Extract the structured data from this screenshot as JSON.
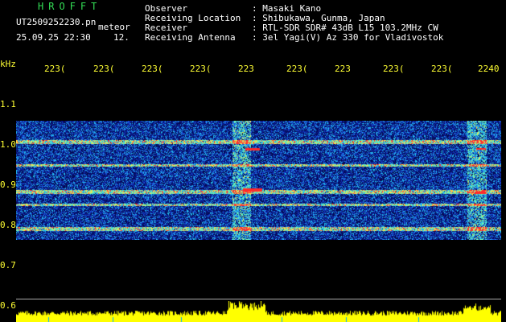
{
  "header": {
    "title_letters": "HROFFT",
    "filename": "UT2509252230.pn",
    "mode": "meteor",
    "date_time": "25.09.25 22:30",
    "frame": "12.",
    "labels": [
      "Observer",
      "Receiving Location",
      "Receiver",
      "Receiving Antenna"
    ],
    "values": [
      ": Masaki Kano",
      ": Shibukawa, Gunma, Japan",
      ": RTL-SDR SDR# 43dB L15 103.2MHz CW",
      ": 3el Yagi(V) Az 330 for Vladivostok"
    ]
  },
  "axes": {
    "y_unit": "kHz",
    "y_ticks": [
      "1.1",
      "1.0",
      "0.9",
      "0.8",
      "0.7",
      "0.6"
    ],
    "x_ticks": [
      "223(",
      "223(",
      "223(",
      "223(",
      "223",
      "223(",
      "223",
      "223(",
      "223(",
      "2240"
    ]
  },
  "colors": {
    "text_white": "#ffffff",
    "text_yellow": "#ffff33",
    "title_green": "#33dd55",
    "spectro_low": "#0018a8",
    "spectro_mid": "#00c8ff",
    "spectro_high": "#ff2020",
    "histogram": "#ffff00"
  }
}
